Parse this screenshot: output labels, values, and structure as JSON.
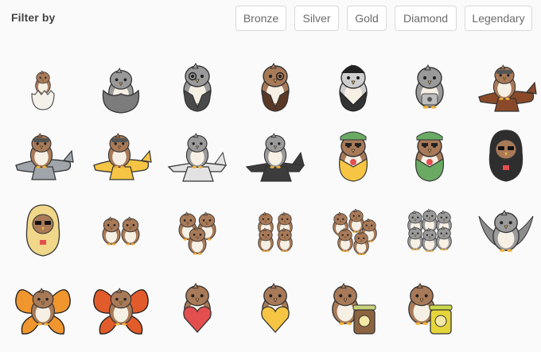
{
  "header": {
    "filter_label": "Filter by"
  },
  "filters": [
    {
      "label": "Bronze"
    },
    {
      "label": "Silver"
    },
    {
      "label": "Gold"
    },
    {
      "label": "Diamond"
    },
    {
      "label": "Legendary"
    }
  ],
  "colors": {
    "brown": "#a97a58",
    "brown_dark": "#6f4a30",
    "cream": "#f6efe4",
    "beak": "#f2b23a",
    "gray": "#9a9a9a",
    "gray_dark": "#5e5e5e",
    "yellow": "#f6c544",
    "red": "#e34f4f",
    "green": "#6aaa63",
    "black": "#2e2e2e",
    "orange": "#e8892b"
  },
  "stickers": [
    {
      "name": "egg-chick",
      "kind": "egg",
      "tone": "brown"
    },
    {
      "name": "blanket-owl",
      "kind": "blanket",
      "tone": "gray"
    },
    {
      "name": "suit-owl-gray",
      "kind": "suit",
      "tone": "gray"
    },
    {
      "name": "monocle-owl",
      "kind": "suit",
      "tone": "brown"
    },
    {
      "name": "bw-beanie-owl",
      "kind": "beanie",
      "tone": "bw"
    },
    {
      "name": "robot-owl",
      "kind": "robot",
      "tone": "gray"
    },
    {
      "name": "pilot-owl-brown-plane",
      "kind": "plane",
      "tone": "brown"
    },
    {
      "name": "pilot-owl-gray-plane",
      "kind": "plane",
      "tone": "gray"
    },
    {
      "name": "pilot-owl-yellow-plane",
      "kind": "plane",
      "tone": "yellow"
    },
    {
      "name": "jet-owl-white",
      "kind": "jet",
      "tone": "white"
    },
    {
      "name": "jet-owl-black",
      "kind": "jet",
      "tone": "black"
    },
    {
      "name": "tropical-owl-yellow",
      "kind": "tropical",
      "tone": "yellow"
    },
    {
      "name": "tropical-owl-green",
      "kind": "tropical",
      "tone": "green"
    },
    {
      "name": "hoodie-owl-black",
      "kind": "hoodie",
      "tone": "black"
    },
    {
      "name": "hoodie-owl-yellow",
      "kind": "hoodie",
      "tone": "yellow"
    },
    {
      "name": "owl-pair",
      "kind": "group",
      "count": 2,
      "tone": "brown"
    },
    {
      "name": "owl-trio",
      "kind": "group",
      "count": 3,
      "tone": "brown"
    },
    {
      "name": "owl-quad",
      "kind": "group",
      "count": 4,
      "tone": "brown"
    },
    {
      "name": "owl-group-five",
      "kind": "group",
      "count": 5,
      "tone": "brown"
    },
    {
      "name": "owl-crowd-gray",
      "kind": "group",
      "count": 6,
      "tone": "gray"
    },
    {
      "name": "flying-owl-gray",
      "kind": "flying",
      "tone": "gray"
    },
    {
      "name": "butterfly-owl-orange",
      "kind": "butterfly",
      "tone": "orange"
    },
    {
      "name": "butterfly-owl-red",
      "kind": "butterfly",
      "tone": "red"
    },
    {
      "name": "heart-owl-red",
      "kind": "heart",
      "tone": "red"
    },
    {
      "name": "heart-owl-yellow",
      "kind": "heart",
      "tone": "yellow"
    },
    {
      "name": "jar-owl-brown",
      "kind": "jar",
      "tone": "brown"
    },
    {
      "name": "jar-owl-yellow",
      "kind": "jar",
      "tone": "yellow"
    }
  ]
}
